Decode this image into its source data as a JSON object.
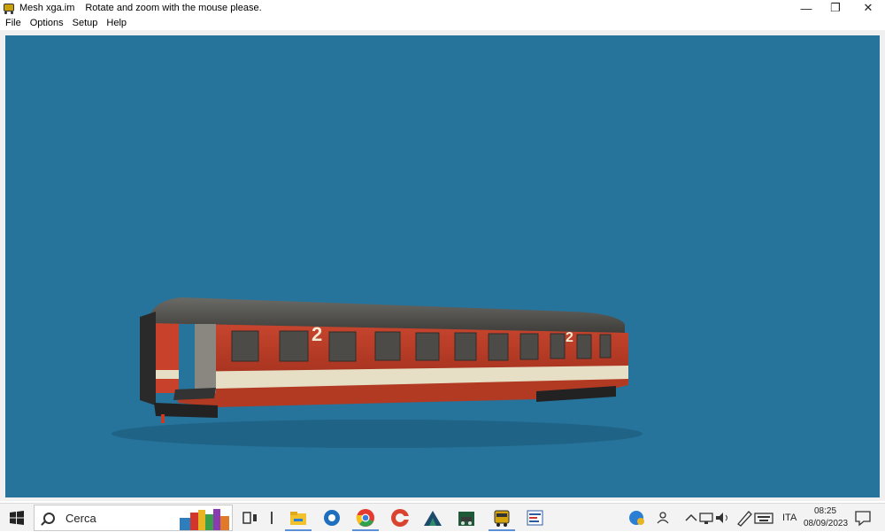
{
  "window": {
    "title_file": "Mesh xga.im",
    "title_message": "Rotate and zoom with the mouse please.",
    "minimize_glyph": "—",
    "restore_glyph": "❐",
    "close_glyph": "✕"
  },
  "menu": [
    "File",
    "Options",
    "Setup",
    "Help"
  ],
  "scene": {
    "background": "#26739b",
    "coach_number_1": "2",
    "coach_number_2": "2"
  },
  "taskbar": {
    "search_placeholder": "Cerca",
    "language": "ITA",
    "time": "08:25",
    "date": "08/09/2023",
    "pinned_icons": [
      "books-icon",
      "task-view-icon",
      "divider-icon",
      "file-explorer-icon",
      "tool-icon",
      "chrome-icon",
      "ccleaner-icon",
      "mountain-app-icon",
      "locomotive-app-icon",
      "train-mesh-icon",
      "editor-icon"
    ],
    "tray_icons": [
      "help-icon",
      "people-icon",
      "chevron-up-icon",
      "network-icon",
      "volume-icon",
      "pen-icon",
      "keyboard-icon",
      "notification-icon"
    ]
  }
}
